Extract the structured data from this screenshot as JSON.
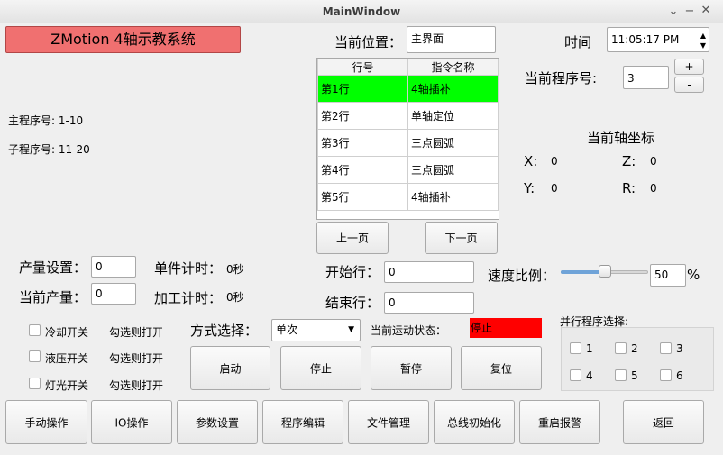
{
  "window": {
    "title": "MainWindow",
    "minimize": "⌄",
    "restore": "−",
    "maximize": "+",
    "close": "✕"
  },
  "banner": {
    "text": "ZMotion    4轴示教系统",
    "color": "#f07070"
  },
  "main_program_range": "主程序号: 1-10",
  "sub_program_range": "子程序号: 11-20",
  "current_position": {
    "label": "当前位置：",
    "value": "主界面"
  },
  "time": {
    "label": "时间",
    "value": "11:05:17 PM"
  },
  "program_number": {
    "label": "当前程序号:",
    "value": "3",
    "inc": "+",
    "dec": "-"
  },
  "table": {
    "headers": [
      "行号",
      "指令名称"
    ],
    "rows": [
      {
        "line": "第1行",
        "cmd": "4轴插补",
        "selected": true
      },
      {
        "line": "第2行",
        "cmd": "单轴定位"
      },
      {
        "line": "第3行",
        "cmd": "三点圆弧"
      },
      {
        "line": "第4行",
        "cmd": "三点圆弧"
      },
      {
        "line": "第5行",
        "cmd": "4轴插补"
      }
    ],
    "prev_page": "上一页",
    "next_page": "下一页",
    "selected_color": "#00ff00"
  },
  "axis": {
    "title": "当前轴坐标",
    "x_label": "X:",
    "x": "0",
    "y_label": "Y:",
    "y": "0",
    "z_label": "Z:",
    "z": "0",
    "r_label": "R:",
    "r": "0"
  },
  "production": {
    "set_label": "产量设置：",
    "set_value": "0",
    "current_label": "当前产量：",
    "current_value": "0",
    "piece_timer_label": "单件计时：",
    "piece_timer": "0秒",
    "process_timer_label": "加工计时：",
    "process_timer": "0秒"
  },
  "run_range": {
    "start_label": "开始行：",
    "start": "0",
    "end_label": "结束行：",
    "end": "0"
  },
  "speed": {
    "label": "速度比例：",
    "value": "50",
    "unit": "%",
    "fraction": 0.5
  },
  "switches": [
    {
      "label": "冷却开关",
      "hint": "勾选则打开"
    },
    {
      "label": "液压开关",
      "hint": "勾选则打开"
    },
    {
      "label": "灯光开关",
      "hint": "勾选则打开"
    }
  ],
  "mode": {
    "label": "方式选择：",
    "value": "单次"
  },
  "motion_status": {
    "label": "当前运动状态：",
    "value": "停止",
    "color": "#ff0000"
  },
  "control_buttons": [
    "启动",
    "停止",
    "暂停",
    "复位"
  ],
  "parallel": {
    "title": "并行程序选择:",
    "items": [
      "1",
      "2",
      "3",
      "4",
      "5",
      "6"
    ]
  },
  "bottom_buttons": [
    "手动操作",
    "IO操作",
    "参数设置",
    "程序编辑",
    "文件管理",
    "总线初始化",
    "重启报警",
    "返回"
  ]
}
